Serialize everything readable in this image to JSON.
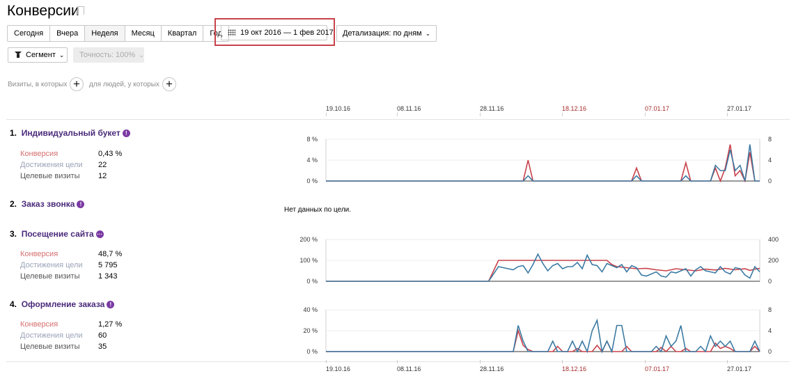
{
  "header": {
    "title": "Конверсии"
  },
  "period_tabs": [
    {
      "label": "Сегодня"
    },
    {
      "label": "Вчера"
    },
    {
      "label": "Неделя"
    },
    {
      "label": "Месяц"
    },
    {
      "label": "Квартал"
    },
    {
      "label": "Год"
    }
  ],
  "date_range": "19 окт 2016 — 1 фев 2017",
  "detail": "Детализация: по дням",
  "segment": "Сегмент",
  "accuracy": "Точность: 100%",
  "filters": {
    "visits": "Визиты, в которых",
    "people": "для людей, у которых"
  },
  "timeline": {
    "labels": [
      {
        "text": "19.10.16",
        "holiday": false
      },
      {
        "text": "08.11.16",
        "holiday": false
      },
      {
        "text": "28.11.16",
        "holiday": false
      },
      {
        "text": "18.12.16",
        "holiday": true
      },
      {
        "text": "07.01.17",
        "holiday": true
      },
      {
        "text": "27.01.17",
        "holiday": false
      }
    ]
  },
  "metric_labels": {
    "conversion": "Конверсия",
    "achievements": "Достижения цели",
    "visits": "Целевые визиты"
  },
  "no_data": "Нет данных по цели.",
  "colors": {
    "conversion": "#c8414a",
    "visits": "#3b7aa3",
    "holiday": "#a52a2a",
    "accent": "#7b3aa3"
  },
  "goals": [
    {
      "number": "1.",
      "name": "Индивидуальный букет",
      "conversion": "0,43 %",
      "achievements": "22",
      "visits": "12",
      "has_data": true
    },
    {
      "number": "2.",
      "name": "Заказ звонка",
      "has_data": false
    },
    {
      "number": "3.",
      "name": "Посещение сайта",
      "conversion": "48,7 %",
      "achievements": "5 795",
      "visits": "1 343",
      "has_data": true
    },
    {
      "number": "4.",
      "name": "Оформление заказа",
      "conversion": "1,27 %",
      "achievements": "60",
      "visits": "35",
      "has_data": true
    }
  ],
  "chart_data": [
    {
      "type": "line",
      "goal": "Индивидуальный букет",
      "y_left_ticks": [
        "8 %",
        "4 %",
        "0 %"
      ],
      "y_right_ticks": [
        "8",
        "4",
        "0"
      ],
      "y_left_range": [
        0,
        8
      ],
      "y_right_range": [
        0,
        8
      ],
      "series": [
        {
          "name": "Конверсия",
          "axis": "left",
          "points": [
            [
              0,
              0
            ],
            [
              40,
              0
            ],
            [
              41,
              4
            ],
            [
              42,
              0
            ],
            [
              62,
              0
            ],
            [
              63,
              2.5
            ],
            [
              64,
              0
            ],
            [
              72,
              0
            ],
            [
              73,
              3.5
            ],
            [
              74,
              0
            ],
            [
              78,
              0
            ],
            [
              79,
              2.5
            ],
            [
              80,
              0
            ],
            [
              81,
              2.5
            ],
            [
              82,
              7
            ],
            [
              83,
              1
            ],
            [
              84,
              2
            ],
            [
              85,
              0
            ],
            [
              86,
              5.5
            ],
            [
              87,
              0
            ],
            [
              88,
              0
            ]
          ]
        },
        {
          "name": "Целевые визиты",
          "axis": "right",
          "points": [
            [
              0,
              0
            ],
            [
              40,
              0
            ],
            [
              41,
              1
            ],
            [
              42,
              0
            ],
            [
              62,
              0
            ],
            [
              63,
              1
            ],
            [
              64,
              0
            ],
            [
              72,
              0
            ],
            [
              73,
              1
            ],
            [
              74,
              0
            ],
            [
              78,
              0
            ],
            [
              79,
              3
            ],
            [
              80,
              2
            ],
            [
              81,
              2
            ],
            [
              82,
              6
            ],
            [
              83,
              2
            ],
            [
              84,
              3
            ],
            [
              85,
              0
            ],
            [
              86,
              7
            ],
            [
              87,
              0
            ],
            [
              88,
              0
            ]
          ]
        }
      ]
    },
    {
      "type": "line",
      "goal": "Заказ звонка",
      "series": []
    },
    {
      "type": "line",
      "goal": "Посещение сайта",
      "y_left_ticks": [
        "200 %",
        "100 %",
        "0 %"
      ],
      "y_right_ticks": [
        "400",
        "200",
        "0"
      ],
      "y_left_range": [
        0,
        200
      ],
      "y_right_range": [
        0,
        400
      ],
      "series": [
        {
          "name": "Конверсия",
          "axis": "left",
          "points": [
            [
              0,
              0
            ],
            [
              33,
              0
            ],
            [
              35,
              100
            ],
            [
              57,
              100
            ],
            [
              58,
              80
            ],
            [
              59,
              70
            ],
            [
              61,
              65
            ],
            [
              63,
              60
            ],
            [
              65,
              62
            ],
            [
              67,
              55
            ],
            [
              69,
              50
            ],
            [
              71,
              60
            ],
            [
              73,
              55
            ],
            [
              75,
              50
            ],
            [
              77,
              58
            ],
            [
              79,
              54
            ],
            [
              81,
              62
            ],
            [
              83,
              55
            ],
            [
              85,
              60
            ],
            [
              86,
              52
            ],
            [
              87,
              58
            ],
            [
              88,
              62
            ]
          ]
        },
        {
          "name": "Целевые визиты",
          "axis": "right",
          "points": [
            [
              0,
              0
            ],
            [
              33,
              0
            ],
            [
              35,
              140
            ],
            [
              37,
              120
            ],
            [
              38,
              110
            ],
            [
              39,
              140
            ],
            [
              40,
              150
            ],
            [
              41,
              80
            ],
            [
              42,
              160
            ],
            [
              43,
              260
            ],
            [
              44,
              170
            ],
            [
              45,
              100
            ],
            [
              46,
              150
            ],
            [
              47,
              170
            ],
            [
              48,
              120
            ],
            [
              49,
              140
            ],
            [
              50,
              140
            ],
            [
              51,
              180
            ],
            [
              52,
              120
            ],
            [
              53,
              250
            ],
            [
              54,
              160
            ],
            [
              55,
              150
            ],
            [
              56,
              90
            ],
            [
              57,
              170
            ],
            [
              58,
              150
            ],
            [
              59,
              130
            ],
            [
              60,
              160
            ],
            [
              61,
              90
            ],
            [
              62,
              150
            ],
            [
              63,
              130
            ],
            [
              64,
              60
            ],
            [
              65,
              50
            ],
            [
              66,
              70
            ],
            [
              67,
              90
            ],
            [
              68,
              50
            ],
            [
              69,
              40
            ],
            [
              70,
              90
            ],
            [
              71,
              80
            ],
            [
              72,
              100
            ],
            [
              73,
              120
            ],
            [
              74,
              50
            ],
            [
              75,
              110
            ],
            [
              76,
              140
            ],
            [
              77,
              100
            ],
            [
              78,
              90
            ],
            [
              79,
              80
            ],
            [
              80,
              140
            ],
            [
              81,
              90
            ],
            [
              82,
              70
            ],
            [
              83,
              130
            ],
            [
              84,
              120
            ],
            [
              85,
              60
            ],
            [
              86,
              30
            ],
            [
              87,
              140
            ],
            [
              88,
              90
            ]
          ]
        }
      ]
    },
    {
      "type": "line",
      "goal": "Оформление заказа",
      "y_left_ticks": [
        "40 %",
        "20 %",
        "0 %"
      ],
      "y_right_ticks": [
        "8",
        "4",
        "0"
      ],
      "y_left_range": [
        0,
        40
      ],
      "y_right_range": [
        0,
        8
      ],
      "series": [
        {
          "name": "Конверсия",
          "axis": "left",
          "points": [
            [
              0,
              0
            ],
            [
              38,
              0
            ],
            [
              39,
              20
            ],
            [
              40,
              6
            ],
            [
              41,
              2
            ],
            [
              42,
              0
            ],
            [
              46,
              0
            ],
            [
              47,
              5
            ],
            [
              48,
              0
            ],
            [
              50,
              0
            ],
            [
              51,
              3
            ],
            [
              52,
              0
            ],
            [
              54,
              0
            ],
            [
              55,
              6
            ],
            [
              56,
              0
            ],
            [
              57,
              10
            ],
            [
              58,
              0
            ],
            [
              60,
              0
            ],
            [
              61,
              5
            ],
            [
              62,
              0
            ],
            [
              67,
              0
            ],
            [
              68,
              4
            ],
            [
              69,
              0
            ],
            [
              70,
              5
            ],
            [
              71,
              0
            ],
            [
              72,
              0
            ],
            [
              73,
              3
            ],
            [
              74,
              0
            ],
            [
              78,
              0
            ],
            [
              79,
              8
            ],
            [
              80,
              3
            ],
            [
              81,
              5
            ],
            [
              82,
              3
            ],
            [
              83,
              0
            ],
            [
              86,
              0
            ],
            [
              87,
              5
            ],
            [
              88,
              0
            ]
          ]
        },
        {
          "name": "Целевые визиты",
          "axis": "right",
          "points": [
            [
              0,
              0
            ],
            [
              38,
              0
            ],
            [
              39,
              5
            ],
            [
              40,
              2
            ],
            [
              41,
              0
            ],
            [
              45,
              0
            ],
            [
              46,
              2
            ],
            [
              47,
              0
            ],
            [
              49,
              0
            ],
            [
              50,
              2
            ],
            [
              51,
              0
            ],
            [
              52,
              2
            ],
            [
              53,
              0
            ],
            [
              54,
              4
            ],
            [
              55,
              6
            ],
            [
              56,
              0
            ],
            [
              57,
              2
            ],
            [
              58,
              0
            ],
            [
              59,
              5
            ],
            [
              60,
              5
            ],
            [
              61,
              0
            ],
            [
              66,
              0
            ],
            [
              67,
              1
            ],
            [
              68,
              0
            ],
            [
              69,
              3
            ],
            [
              70,
              1
            ],
            [
              71,
              2
            ],
            [
              72,
              5
            ],
            [
              73,
              0
            ],
            [
              75,
              0
            ],
            [
              76,
              1
            ],
            [
              77,
              0
            ],
            [
              78,
              3
            ],
            [
              79,
              1
            ],
            [
              80,
              2
            ],
            [
              81,
              1
            ],
            [
              82,
              2
            ],
            [
              83,
              0
            ],
            [
              86,
              0
            ],
            [
              87,
              2
            ],
            [
              88,
              0
            ]
          ]
        }
      ]
    }
  ]
}
